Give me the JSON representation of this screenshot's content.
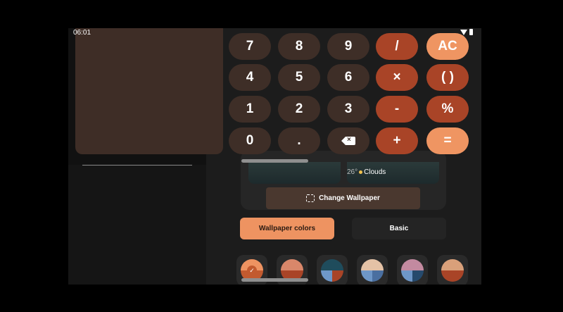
{
  "status_bar": {
    "time": "06:01",
    "wifi_icon": "wifi-icon",
    "battery_icon": "battery-icon"
  },
  "calculator": {
    "rows": [
      [
        {
          "label": "7",
          "kind": "num"
        },
        {
          "label": "8",
          "kind": "num"
        },
        {
          "label": "9",
          "kind": "num"
        },
        {
          "label": "/",
          "kind": "op"
        },
        {
          "label": "AC",
          "kind": "acc"
        }
      ],
      [
        {
          "label": "4",
          "kind": "num"
        },
        {
          "label": "5",
          "kind": "num"
        },
        {
          "label": "6",
          "kind": "num"
        },
        {
          "label": "×",
          "kind": "op"
        },
        {
          "label": "( )",
          "kind": "op"
        }
      ],
      [
        {
          "label": "1",
          "kind": "num"
        },
        {
          "label": "2",
          "kind": "num"
        },
        {
          "label": "3",
          "kind": "num"
        },
        {
          "label": "-",
          "kind": "op"
        },
        {
          "label": "%",
          "kind": "op"
        }
      ],
      [
        {
          "label": "0",
          "kind": "num"
        },
        {
          "label": ".",
          "kind": "num"
        },
        {
          "label": "",
          "kind": "num",
          "icon": "backspace-icon"
        },
        {
          "label": "+",
          "kind": "op"
        },
        {
          "label": "=",
          "kind": "acc"
        }
      ]
    ],
    "colors": {
      "num": "#3e2e27",
      "op": "#a94427",
      "acc": "#ef9562"
    }
  },
  "wallpaper": {
    "weather_temp": "26°",
    "weather_label": "Clouds",
    "change_button": "Change Wallpaper"
  },
  "tabs": {
    "wallpaper_colors": "Wallpaper colors",
    "basic": "Basic"
  },
  "swatches": [
    {
      "name": "swatch-1",
      "colors": [
        "#ee9361",
        "#ee9361",
        "#c25a2f",
        "#c25a2f"
      ],
      "selected": true
    },
    {
      "name": "swatch-2",
      "colors": [
        "#d9876a",
        "#d9876a",
        "#a94427",
        "#a94427"
      ],
      "selected": false
    },
    {
      "name": "swatch-3",
      "colors": [
        "#1f4c5c",
        "#1f4c5c",
        "#6e97c8",
        "#a94427"
      ],
      "selected": false
    },
    {
      "name": "swatch-4",
      "colors": [
        "#e4c2a6",
        "#e4c2a6",
        "#6e97c8",
        "#4a6fa0"
      ],
      "selected": false
    },
    {
      "name": "swatch-5",
      "colors": [
        "#c38aa0",
        "#c38aa0",
        "#6e97c8",
        "#264a6d"
      ],
      "selected": false
    },
    {
      "name": "swatch-6",
      "colors": [
        "#d9a07a",
        "#d9a07a",
        "#a94427",
        "#a94427"
      ],
      "selected": false
    }
  ]
}
